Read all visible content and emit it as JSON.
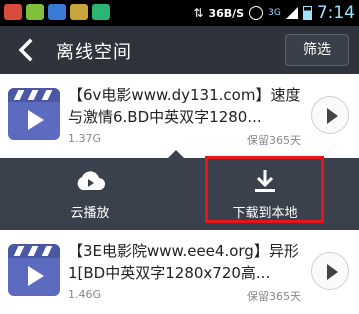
{
  "statusbar": {
    "speed": "36B/S",
    "network": "3G",
    "time": "7:14"
  },
  "appbar": {
    "title": "离线空间",
    "filter_label": "筛选"
  },
  "items": [
    {
      "name": "【6v电影www.dy131.com】速度与激情6.BD中英双字1280...",
      "size": "1.37G",
      "keep": "保留365天"
    },
    {
      "name": "【3E电影院www.eee4.org】异形1[BD中英双字1280x720高...",
      "size": "1.46G",
      "keep": "保留365天"
    }
  ],
  "actions": {
    "cloud_play": "云播放",
    "download_local": "下载到本地"
  }
}
